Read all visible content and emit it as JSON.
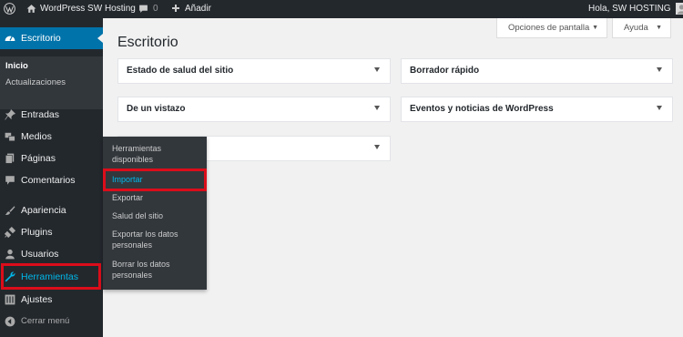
{
  "admin_bar": {
    "site_name": "WordPress SW Hosting",
    "comments_count": "0",
    "new_label": "Añadir",
    "greeting": "Hola, SW HOSTING"
  },
  "sidebar": {
    "escritorio": "Escritorio",
    "submenu": {
      "inicio": "Inicio",
      "actualizaciones": "Actualizaciones"
    },
    "items": {
      "entradas": "Entradas",
      "medios": "Medios",
      "paginas": "Páginas",
      "comentarios": "Comentarios",
      "apariencia": "Apariencia",
      "plugins": "Plugins",
      "usuarios": "Usuarios",
      "herramientas": "Herramientas",
      "ajustes": "Ajustes",
      "cerrar": "Cerrar menú"
    }
  },
  "flyout": {
    "herramientas_disponibles": "Herramientas disponibles",
    "importar": "Importar",
    "exportar": "Exportar",
    "salud": "Salud del sitio",
    "exportar_datos": "Exportar los datos personales",
    "borrar_datos": "Borrar los datos personales"
  },
  "main": {
    "title": "Escritorio",
    "screen_options": "Opciones de pantalla",
    "help": "Ayuda",
    "boxes": {
      "salud": "Estado de salud del sitio",
      "borrador": "Borrador rápido",
      "vistazo": "De un vistazo",
      "eventos": "Eventos y noticias de WordPress",
      "actividad": ""
    }
  },
  "colors": {
    "admin_dark": "#23282d",
    "accent": "#0073aa",
    "highlight": "#dc0d1a",
    "link_active": "#00b9eb"
  },
  "icons": [
    "wordpress-logo",
    "home-icon",
    "comment-icon",
    "plus-icon",
    "avatar",
    "dashboard-icon",
    "pin-icon",
    "media-icon",
    "pages-icon",
    "comments-icon",
    "appearance-icon",
    "plugins-icon",
    "users-icon",
    "wrench-icon",
    "settings-icon",
    "collapse-icon"
  ]
}
